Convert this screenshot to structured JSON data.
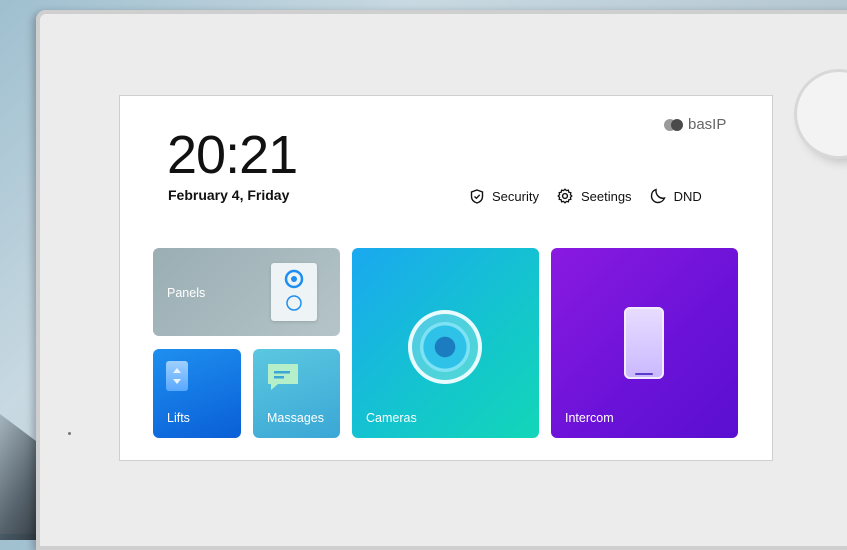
{
  "header": {
    "time": "20:21",
    "date": "February 4, Friday",
    "logo_text": "basIP"
  },
  "toolbar": {
    "security_label": "Security",
    "settings_label": "Seetings",
    "dnd_label": "DND"
  },
  "tiles": {
    "panels": "Panels",
    "lifts": "Lifts",
    "massages": "Massages",
    "cameras": "Cameras",
    "intercom": "Intercom"
  },
  "colors": {
    "panels": "#9aaeb3",
    "lifts": "#0a5fd6",
    "massages": "#3aa7d6",
    "cameras": "#14c4cf",
    "intercom": "#6a12d8"
  },
  "icons": {
    "security": "shield-check-icon",
    "settings": "gear-icon",
    "dnd": "moon-icon",
    "panels": "doorbell-icon",
    "lifts": "elevator-arrows-icon",
    "massages": "message-bubble-icon",
    "cameras": "camera-lens-icon",
    "intercom": "phone-handset-icon"
  }
}
